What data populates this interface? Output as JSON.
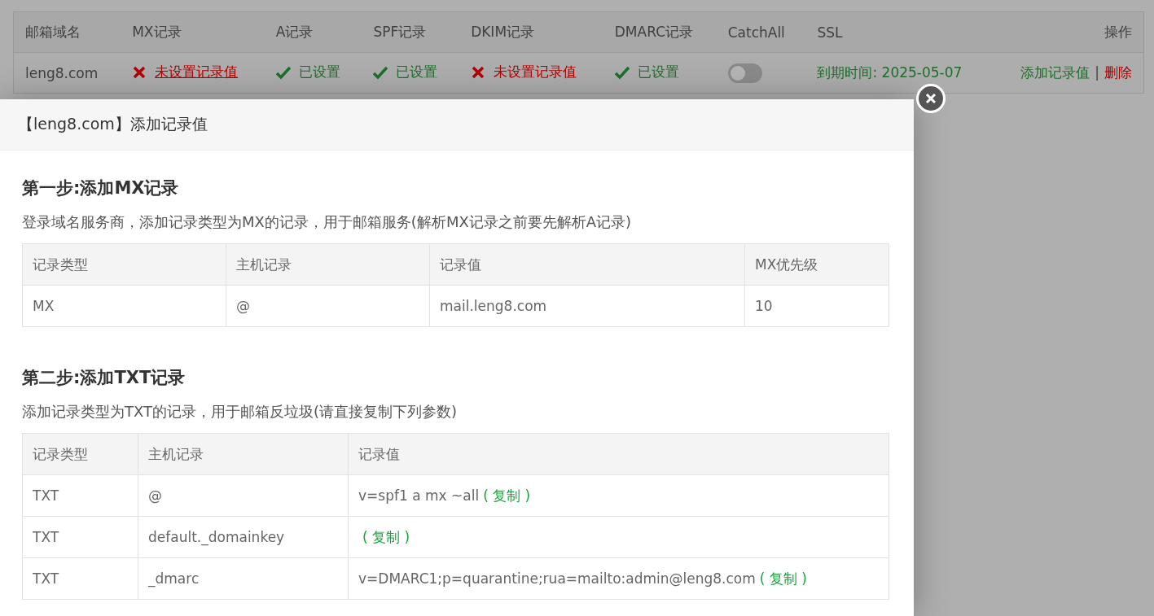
{
  "domain_table": {
    "columns": [
      "邮箱域名",
      "MX记录",
      "A记录",
      "SPF记录",
      "DKIM记录",
      "DMARC记录",
      "CatchAll",
      "SSL",
      "操作"
    ],
    "rows": [
      {
        "domain": "leng8.com",
        "records": [
          {
            "set": false,
            "link": true,
            "text": "未设置记录值"
          },
          {
            "set": true,
            "link": false,
            "text": "已设置"
          },
          {
            "set": true,
            "link": false,
            "text": "已设置"
          },
          {
            "set": false,
            "link": false,
            "text": "未设置记录值"
          },
          {
            "set": true,
            "link": false,
            "text": "已设置"
          }
        ],
        "catchall": {
          "on": false
        },
        "ssl": "到期时间: 2025-05-07",
        "actions": [
          {
            "kind": "add",
            "label": "添加记录值"
          },
          {
            "kind": "separator",
            "label": "|"
          },
          {
            "kind": "delete",
            "label": "删除"
          }
        ]
      }
    ]
  },
  "dialog": {
    "title": "【leng8.com】添加记录值",
    "sections": [
      {
        "heading": "第一步:添加MX记录",
        "description": "登录域名服务商，添加记录类型为MX的记录，用于邮箱服务(解析MX记录之前要先解析A记录)",
        "columns": [
          "记录类型",
          "主机记录",
          "记录值",
          "MX优先级"
        ],
        "rows": [
          {
            "cells": [
              "MX",
              "@",
              "mail.leng8.com",
              "10"
            ]
          }
        ]
      },
      {
        "heading": "第二步:添加TXT记录",
        "description": "添加记录类型为TXT的记录，用于邮箱反垃圾(请直接复制下列参数)",
        "columns": [
          "记录类型",
          "主机记录",
          "记录值"
        ],
        "rows": [
          {
            "cells": [
              "TXT",
              "@",
              "v=spf1 a mx ~all"
            ],
            "copy": "( 复制 )"
          },
          {
            "cells": [
              "TXT",
              "default._domainkey",
              ""
            ],
            "copy": "( 复制 )"
          },
          {
            "cells": [
              "TXT",
              "_dmarc",
              "v=DMARC1;p=quarantine;rua=mailto:admin@leng8.com"
            ],
            "copy": "( 复制 )"
          }
        ]
      }
    ]
  }
}
